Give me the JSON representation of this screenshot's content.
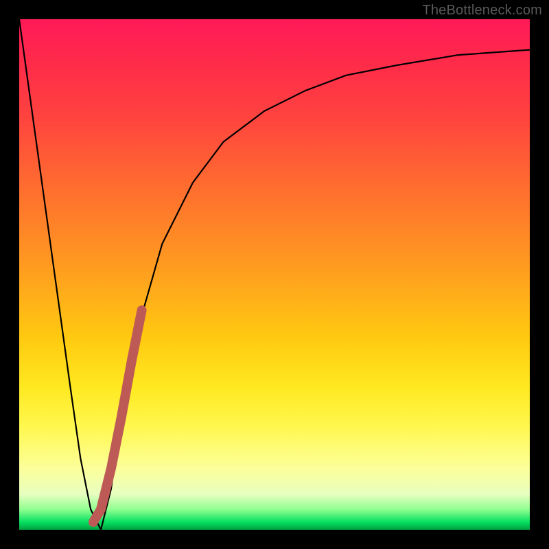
{
  "watermark": "TheBottleneck.com",
  "colors": {
    "curve": "#000000",
    "highlight": "#bd5a56",
    "frame": "#000000"
  },
  "chart_data": {
    "type": "line",
    "title": "",
    "xlabel": "",
    "ylabel": "",
    "xlim": [
      0,
      100
    ],
    "ylim": [
      0,
      100
    ],
    "grid": false,
    "series": [
      {
        "name": "bottleneck-curve",
        "x": [
          0,
          5,
          10,
          12,
          14,
          16,
          18,
          20,
          24,
          28,
          34,
          40,
          48,
          56,
          64,
          74,
          86,
          100
        ],
        "values": [
          100,
          64,
          28,
          14,
          4,
          0,
          8,
          22,
          42,
          56,
          68,
          76,
          82,
          86,
          89,
          91,
          93,
          94
        ]
      },
      {
        "name": "highlight-segment",
        "x": [
          14.5,
          16,
          18,
          20,
          22,
          24
        ],
        "values": [
          1.5,
          4,
          12,
          22,
          33,
          43
        ]
      }
    ],
    "legend": false
  }
}
